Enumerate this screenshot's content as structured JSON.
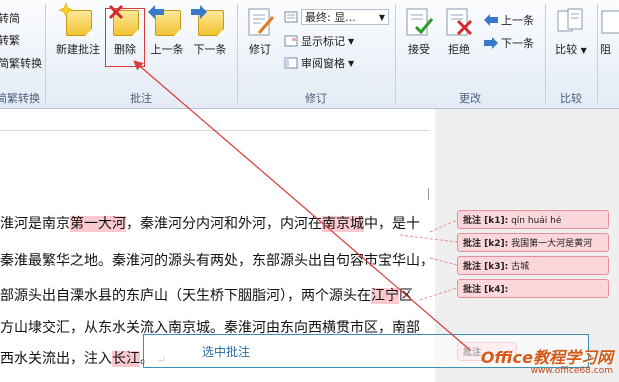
{
  "ribbon": {
    "conversion": {
      "items": [
        "转简",
        "转繁",
        "简繁转换"
      ],
      "label": "简繁转换"
    },
    "comments": {
      "new_label": "新建批注",
      "delete_label": "删除",
      "prev_label": "上一条",
      "next_label": "下一条",
      "group_label": "批注"
    },
    "tracking": {
      "track_label": "修订",
      "display_select": "最终: 显...",
      "show_markup": "显示标记",
      "review_pane": "审阅窗格",
      "group_label": "修订"
    },
    "changes": {
      "accept_label": "接受",
      "reject_label": "拒绝",
      "prev_label": "上一条",
      "next_label": "下一条",
      "group_label": "更改"
    },
    "compare": {
      "compare_label": "比较",
      "group_label": "比较"
    },
    "protect": {
      "partial_label": "阻"
    }
  },
  "document": {
    "lines": [
      {
        "parts": [
          {
            "t": "淮河是南京"
          },
          {
            "t": "第一大河",
            "hl": true
          },
          {
            "t": "，秦淮河分内河和外河，内河在"
          },
          {
            "t": "南京城",
            "hl": true
          },
          {
            "t": "中，是十"
          }
        ]
      },
      {
        "parts": [
          {
            "t": "秦淮最繁华之地。秦淮河的源头有两处，东部源头出自句容市宝华山，"
          }
        ]
      },
      {
        "parts": [
          {
            "t": "部源头出自溧水县的东庐山（天生桥下胭脂河），两个源头在"
          },
          {
            "t": "江宁",
            "hl": true
          },
          {
            "t": "区"
          }
        ]
      },
      {
        "parts": [
          {
            "t": "方山埭交汇，从东水关流入南京城。秦淮河由东向西横贯市区，南部"
          }
        ]
      },
      {
        "parts": [
          {
            "t": "西水关流出，注入"
          },
          {
            "t": "长江",
            "hl": true
          },
          {
            "t": "。"
          }
        ]
      }
    ],
    "return_mark": "↵"
  },
  "balloons": [
    {
      "tag": "批注 [k1]:",
      "text": "qín huái hé"
    },
    {
      "tag": "批注 [k2]:",
      "text": "我国第一大河是黄河"
    },
    {
      "tag": "批注 [k3]:",
      "text": "古城"
    },
    {
      "tag": "批注 [k4]:",
      "text": ""
    },
    {
      "tag": "批注",
      "text": ""
    }
  ],
  "callout_text": "选中批注",
  "watermark": {
    "line1": "Office教程学习网",
    "line2": "www.office68.com"
  },
  "colors": {
    "highlight": "#f9c9cf",
    "balloon_fill": "#fbd6db",
    "balloon_border": "#e5909b",
    "arrow": "#d83b3b",
    "callout_border": "#3a8fb5"
  }
}
